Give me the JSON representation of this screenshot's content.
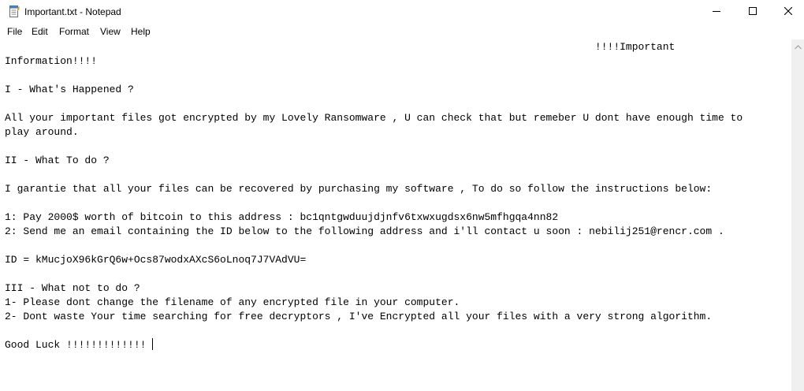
{
  "window": {
    "title": "Important.txt - Notepad",
    "icons": {
      "app": "notepad-icon",
      "minimize": "minimize-icon",
      "maximize": "maximize-icon",
      "close": "close-icon"
    }
  },
  "menubar": {
    "items": [
      {
        "label": "File"
      },
      {
        "label": "Edit"
      },
      {
        "label": "Format"
      },
      {
        "label": "View"
      },
      {
        "label": "Help"
      }
    ]
  },
  "document": {
    "lines": [
      "                                                                                                !!!!Important",
      "Information!!!!",
      "",
      "I - What's Happened ?",
      "",
      "All your important files got encrypted by my Lovely Ransomware , U can check that but remeber U dont have enough time to",
      "play around.",
      "",
      "II - What To do ?",
      "",
      "I garantie that all your files can be recovered by purchasing my software , To do so follow the instructions below:",
      "",
      "1: Pay 2000$ worth of bitcoin to this address : bc1qntgwduujdjnfv6txwxugdsx6nw5mfhgqa4nn82",
      "2: Send me an email containing the ID below to the following address and i'll contact u soon : nebilij251@rencr.com .",
      "",
      "ID = kMucjoX96kGrQ6w+Ocs87wodxAXcS6oLnoq7J7VAdVU=",
      "",
      "III - What not to do ?",
      "1- Please dont change the filename of any encrypted file in your computer.",
      "2- Dont waste Your time searching for free decryptors , I've Encrypted all your files with a very strong algorithm.",
      "",
      "Good Luck !!!!!!!!!!!!! "
    ]
  },
  "colors": {
    "background": "#ffffff",
    "text": "#000000",
    "scrollbar": "#f0f0f0"
  }
}
